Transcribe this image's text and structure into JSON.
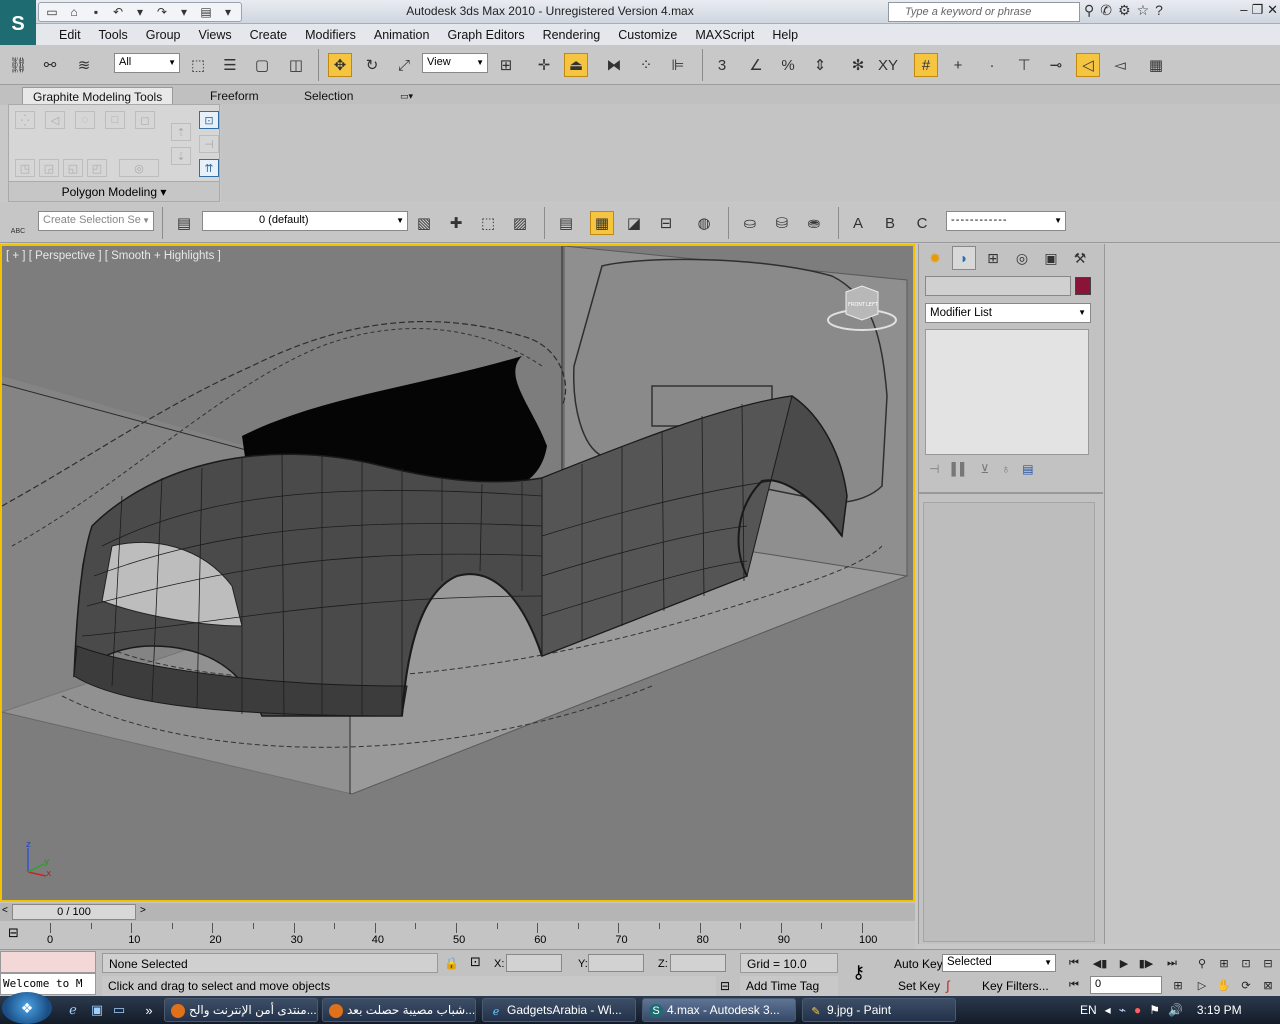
{
  "window": {
    "title": "Autodesk 3ds Max  2010   - Unregistered Version    4.max",
    "search_placeholder": "Type a keyword or phrase",
    "logo_letter": "S"
  },
  "menu": [
    "Edit",
    "Tools",
    "Group",
    "Views",
    "Create",
    "Modifiers",
    "Animation",
    "Graph Editors",
    "Rendering",
    "Customize",
    "MAXScript",
    "Help"
  ],
  "toolbar": {
    "selection_filter": "All",
    "ref_coord": "View",
    "snap_label": "3",
    "xy_label": "XY"
  },
  "ribbon": {
    "tabs": [
      "Graphite Modeling Tools",
      "Freeform",
      "Selection"
    ],
    "panel_label": "Polygon Modeling"
  },
  "toolbar2": {
    "selection_set_placeholder": "Create Selection Se",
    "layer": "0 (default)",
    "abc_label": "ABC",
    "a_label": "A",
    "b_label": "B",
    "c_label": "C"
  },
  "viewport": {
    "label": "[ + ] [ Perspective ] [ Smooth + Highlights ]",
    "axis_z": "z",
    "axis_x": "x",
    "axis_y": "y",
    "cube_front": "FRONT",
    "cube_left": "LEFT"
  },
  "command_panel": {
    "modifier_list": "Modifier List",
    "object_color": "#8a1438"
  },
  "timeline": {
    "current": "0 / 100",
    "prev": "<",
    "next": ">",
    "ticks": [
      "0",
      "10",
      "20",
      "30",
      "40",
      "50",
      "60",
      "70",
      "80",
      "90",
      "100"
    ]
  },
  "status": {
    "welcome": "Welcome to M",
    "selection": "None Selected",
    "prompt": "Click and drag to select and move objects",
    "x_label": "X:",
    "y_label": "Y:",
    "z_label": "Z:",
    "grid": "Grid = 10.0",
    "add_time_tag": "Add Time Tag",
    "auto_key": "Auto Key",
    "set_key": "Set Key",
    "key_mode": "Selected",
    "key_filters": "Key Filters...",
    "frame": "0"
  },
  "taskbar": {
    "items": [
      "منتدى أمن الإنترنت والح...",
      "شباب مصيبة حصلت بعد...",
      "GadgetsArabia - Wi...",
      "4.max - Autodesk 3...",
      "9.jpg - Paint"
    ],
    "language": "EN",
    "time": "3:19 PM"
  }
}
